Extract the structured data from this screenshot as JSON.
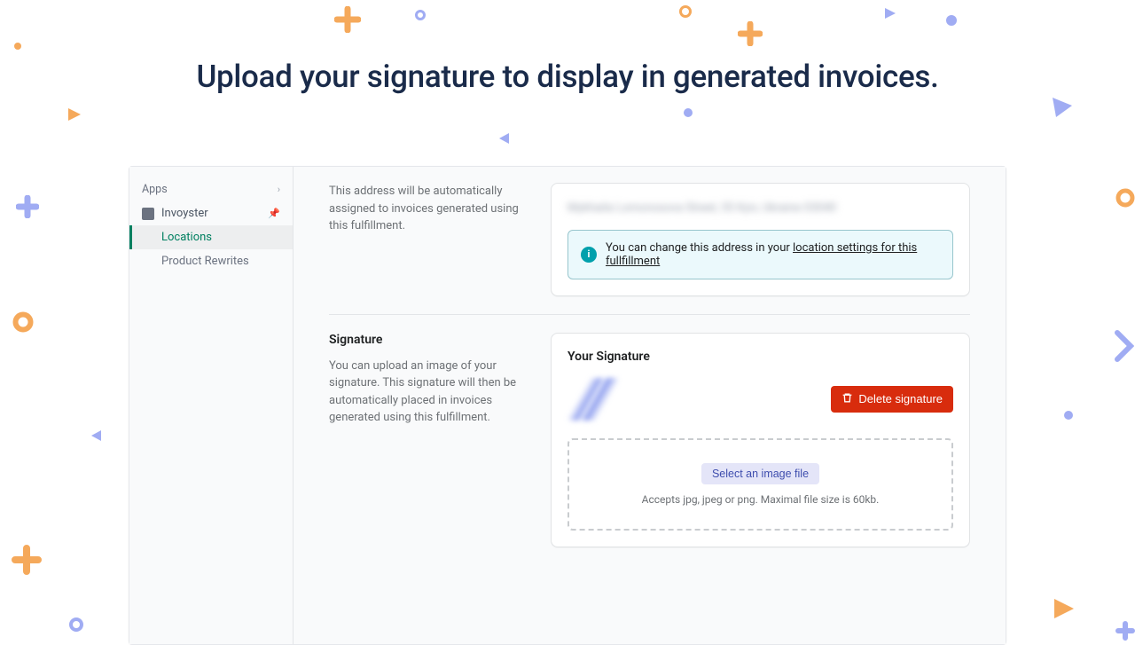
{
  "hero": {
    "title": "Upload your signature to display in generated invoices."
  },
  "sidebar": {
    "heading": "Apps",
    "app_name": "Invoyster",
    "items": [
      {
        "label": "Locations",
        "active": true
      },
      {
        "label": "Product Rewrites",
        "active": false
      }
    ]
  },
  "address_section": {
    "description": "This address will be automatically assigned to invoices generated using this fulfillment.",
    "blurred_placeholder": "Mykhaila Lomonosova Street, 55\nKyiv, Ukraine\n03040",
    "banner_text": "You can change this address in your ",
    "banner_link": "location settings for this fullfillment"
  },
  "signature_section": {
    "title": "Signature",
    "description": "You can upload an image of your signature. This signature will then be automatically placed in invoices generated using this fulfillment.",
    "card_title": "Your Signature",
    "delete_button": "Delete signature",
    "select_button": "Select an image file",
    "upload_hint": "Accepts jpg, jpeg or png. Maximal file size is 60kb."
  }
}
